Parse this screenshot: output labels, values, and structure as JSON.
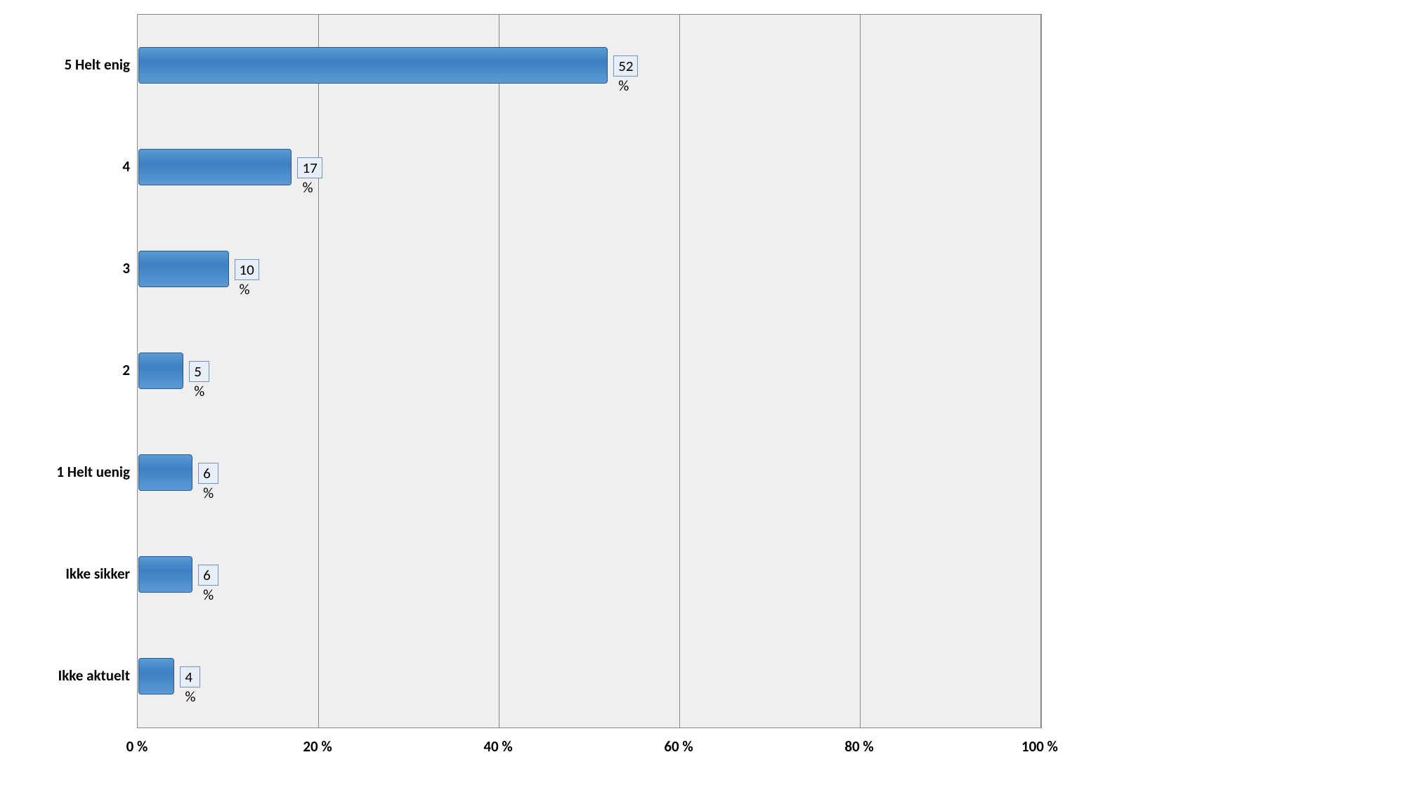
{
  "chart_data": {
    "type": "bar",
    "orientation": "horizontal",
    "categories": [
      "5 Helt enig",
      "4",
      "3",
      "2",
      "1 Helt uenig",
      "Ikke sikker",
      "Ikke aktuelt"
    ],
    "values": [
      52,
      17,
      10,
      5,
      6,
      6,
      4
    ],
    "value_labels": [
      "52 %",
      "17 %",
      "10 %",
      "5 %",
      "6 %",
      "6 %",
      "4 %"
    ],
    "xlabel": "",
    "ylabel": "",
    "xlim": [
      0,
      100
    ],
    "x_ticks": [
      0,
      20,
      40,
      60,
      80,
      100
    ],
    "x_tick_labels": [
      "0 %",
      "20 %",
      "40 %",
      "60 %",
      "80 %",
      "100 %"
    ],
    "title": "",
    "grid": true,
    "series_color": "#4a8bc9"
  }
}
